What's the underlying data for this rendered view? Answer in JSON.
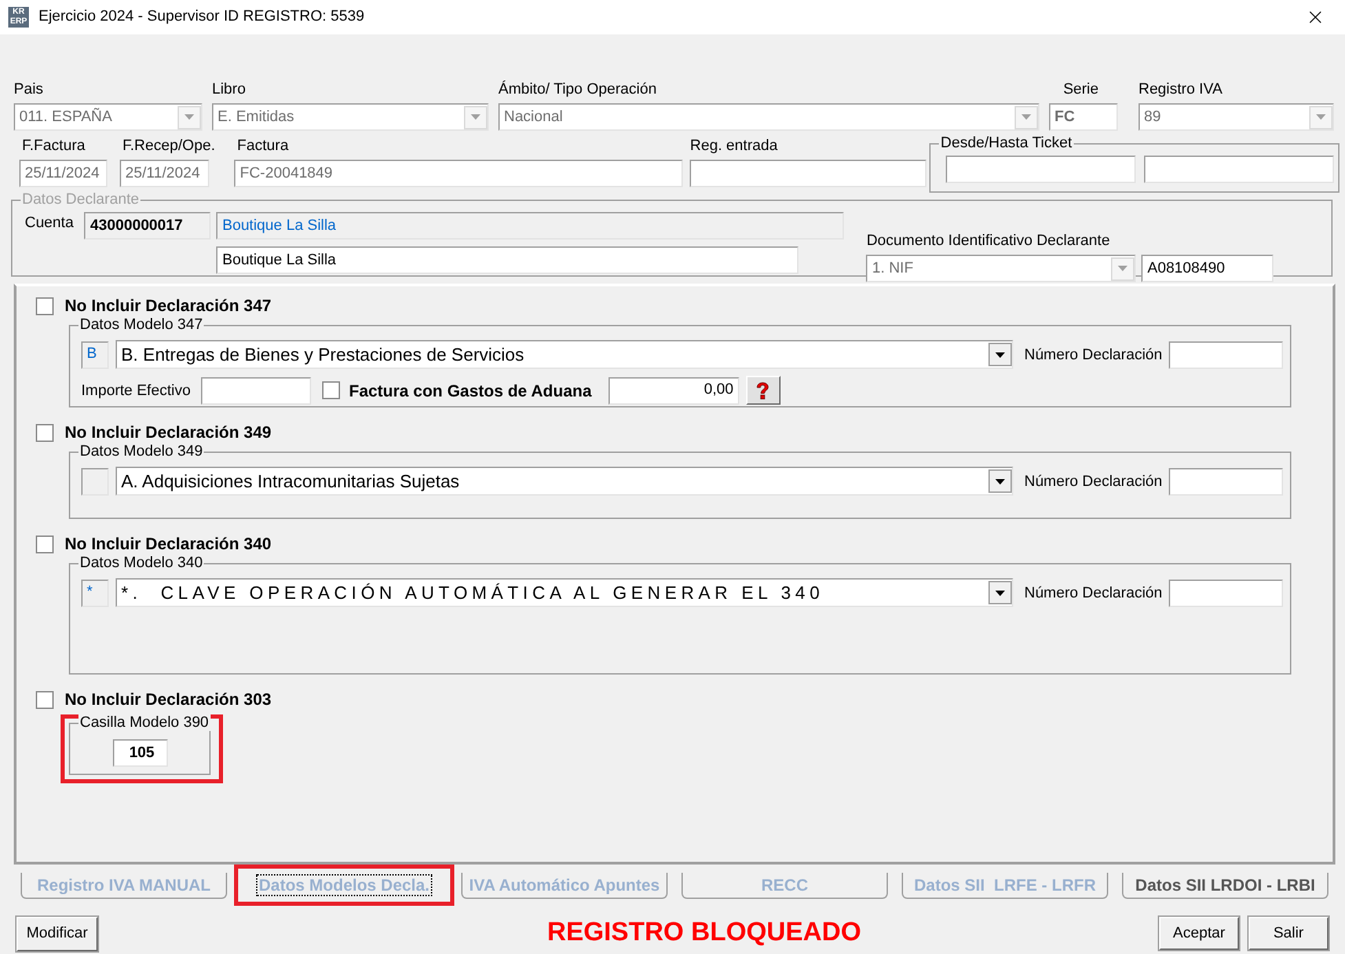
{
  "window": {
    "logo": [
      "KR",
      "ERP"
    ],
    "title": "Ejercicio 2024 - Supervisor ID REGISTRO: 5539"
  },
  "top_fields": [
    {
      "kind": "select",
      "label": "Pais",
      "value": "011.  ESPAÑA",
      "disabled": true
    },
    {
      "kind": "select",
      "label": "Libro",
      "value": "E. Emitidas",
      "disabled": true
    },
    {
      "kind": "select",
      "label": "Ámbito/ Tipo Operación",
      "value": "Nacional",
      "disabled": true
    },
    {
      "kind": "text",
      "label": "Serie",
      "value": "FC",
      "disabled": true
    },
    {
      "kind": "select",
      "label": "Registro IVA",
      "value": "89",
      "disabled": true
    }
  ],
  "second_fields": [
    {
      "label": "F.Factura",
      "value": "25/11/2024",
      "disabled": true
    },
    {
      "label": "F.Recep/Ope.",
      "value": "25/11/2024",
      "disabled": true
    },
    {
      "label": "Factura",
      "value": "FC-20041849",
      "disabled": true
    },
    {
      "label": "Reg. entrada"
    }
  ],
  "ticket": {
    "title": "Desde/Hasta Ticket"
  },
  "declarante": {
    "title": "Datos Declarante",
    "cuenta_label": "Cuenta",
    "cuenta": "43000000017",
    "nombre": "Boutique La Silla",
    "nombre_2": "Boutique La Silla",
    "documento_label": "Documento Identificativo Declarante",
    "documento_tipo": "1. NIF",
    "documento": "A08108490"
  },
  "sections": [
    {
      "kind": "modelo",
      "checkbox_label": "No Incluir Declaración 347",
      "checked": false,
      "group_title": "Datos Modelo 347",
      "code": "B",
      "value": "B. Entregas de Bienes y Prestaciones de Servicios",
      "wide_lettering": false,
      "numero_label": "Número Declaración",
      "importe_label": "Importe Efectivo",
      "aduana_label": "Factura con Gastos de Aduana",
      "aduana_checked": false,
      "amount": "0,00"
    },
    {
      "kind": "modelo",
      "checkbox_label": "No Incluir Declaración 349",
      "checked": false,
      "group_title": "Datos Modelo 349",
      "value": "A. Adquisiciones Intracomunitarias Sujetas",
      "wide_lettering": false,
      "numero_label": "Número Declaración"
    },
    {
      "kind": "modelo",
      "checkbox_label": "No Incluir Declaración 340",
      "checked": false,
      "group_title": "Datos Modelo 340",
      "code": "*",
      "value": "*.  CLAVE OPERACIÓN AUTOMÁTICA AL GENERAR EL 340",
      "wide_lettering": true,
      "numero_label": "Número Declaración"
    },
    {
      "kind": "casilla",
      "checkbox_label": "No Incluir Declaración 303",
      "checked": false,
      "group_title": "Casilla Modelo 390",
      "value": "105",
      "highlighted": true
    }
  ],
  "tabs": [
    {
      "label": "Registro IVA MANUAL",
      "selected": false,
      "disabled": true,
      "highlighted": false
    },
    {
      "label": "Datos Modelos Decla.",
      "selected": true,
      "disabled": true,
      "highlighted": true
    },
    {
      "label": "IVA Automático Apuntes",
      "selected": false,
      "disabled": true,
      "highlighted": false
    },
    {
      "label": "RECC",
      "selected": false,
      "disabled": true,
      "highlighted": false
    },
    {
      "label": "Datos SII  LRFE - LRFR",
      "selected": false,
      "disabled": true,
      "highlighted": false
    },
    {
      "label": "Datos SII LRDOI - LRBI",
      "selected": false,
      "disabled": false,
      "highlighted": false
    }
  ],
  "footer": {
    "left_button": "Modificar",
    "status": "REGISTRO BLOQUEADO",
    "buttons": [
      "Aceptar",
      "Salir"
    ]
  }
}
